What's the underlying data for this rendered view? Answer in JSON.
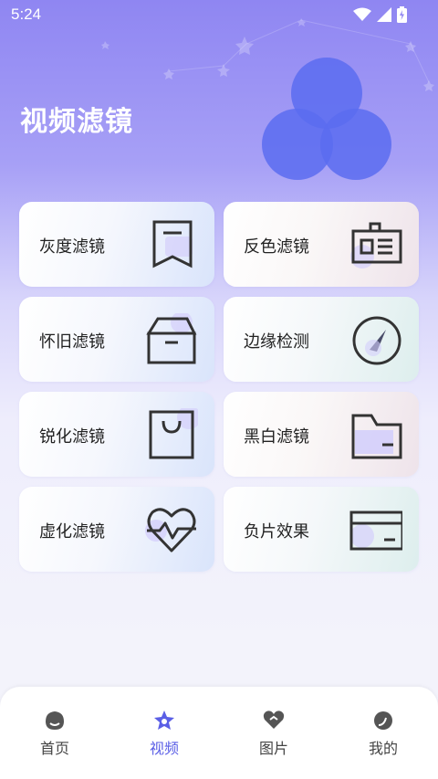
{
  "status": {
    "time": "5:24"
  },
  "page": {
    "title": "视频滤镜"
  },
  "filters": [
    {
      "label": "灰度滤镜",
      "icon": "bookmark-icon"
    },
    {
      "label": "反色滤镜",
      "icon": "id-card-icon"
    },
    {
      "label": "怀旧滤镜",
      "icon": "archive-box-icon"
    },
    {
      "label": "边缘检测",
      "icon": "gauge-icon"
    },
    {
      "label": "锐化滤镜",
      "icon": "shopping-bag-icon"
    },
    {
      "label": "黑白滤镜",
      "icon": "folder-icon"
    },
    {
      "label": "虚化滤镜",
      "icon": "heartbeat-icon"
    },
    {
      "label": "负片效果",
      "icon": "credit-card-icon"
    }
  ],
  "nav": {
    "items": [
      {
        "label": "首页",
        "icon": "home-icon",
        "active": false
      },
      {
        "label": "视频",
        "icon": "video-star-icon",
        "active": true
      },
      {
        "label": "图片",
        "icon": "picture-heart-icon",
        "active": false
      },
      {
        "label": "我的",
        "icon": "profile-icon",
        "active": false
      }
    ]
  },
  "colors": {
    "accent": "#5b5fe6",
    "hero_circle": "#5a6cf0",
    "icon_stroke": "#333333",
    "icon_fill": "#d4cffb"
  }
}
